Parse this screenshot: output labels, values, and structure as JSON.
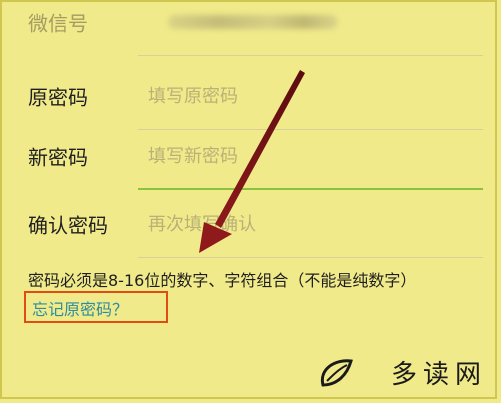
{
  "form": {
    "wechat": {
      "label": "微信号",
      "value_obscured": true
    },
    "old_password": {
      "label": "原密码",
      "placeholder": "填写原密码"
    },
    "new_password": {
      "label": "新密码",
      "placeholder": "填写新密码"
    },
    "confirm_password": {
      "label": "确认密码",
      "placeholder": "再次填写确认"
    },
    "hint": "密码必须是8-16位的数字、字符组合（不能是纯数字）",
    "forgot_link": "忘记原密码？"
  },
  "watermark": {
    "text": "多读网",
    "icon": "leaf-logo-icon"
  },
  "colors": {
    "background": "#f1ea8a",
    "active_underline": "#8ac43f",
    "link": "#2d8ca0",
    "highlight_box": "#e04d13",
    "arrow": "#7a1416"
  }
}
